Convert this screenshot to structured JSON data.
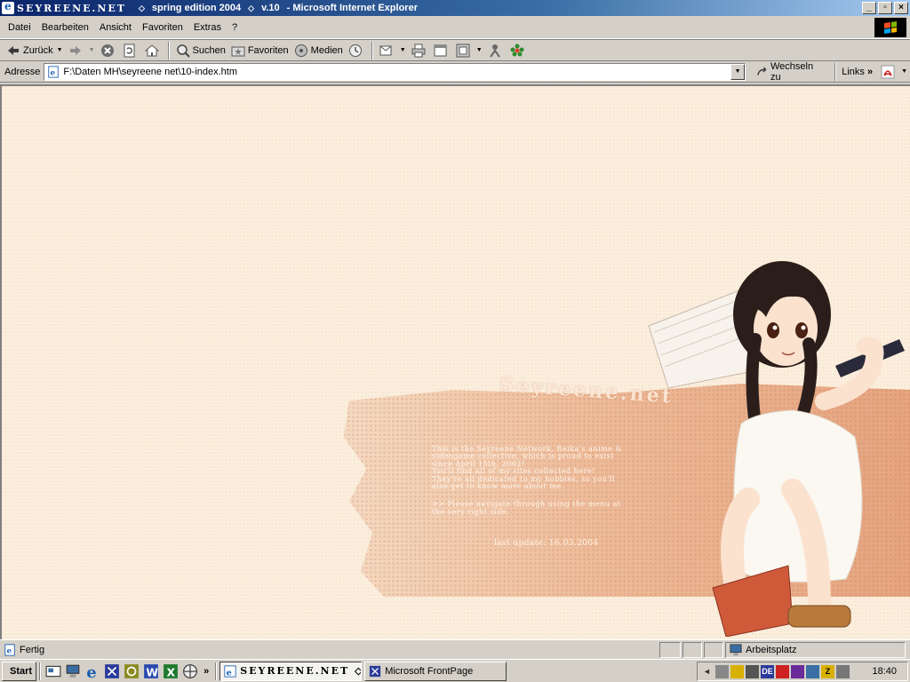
{
  "window": {
    "title_brand": "SEYREENE.NET",
    "title_rest": "spring edition 2004",
    "title_version": "v.10",
    "title_app": "- Microsoft Internet Explorer",
    "diamond": "◇"
  },
  "menu": [
    "Datei",
    "Bearbeiten",
    "Ansicht",
    "Favoriten",
    "Extras",
    "?"
  ],
  "toolbar": {
    "back_label": "Zurück",
    "search_label": "Suchen",
    "favorites_label": "Favoriten",
    "media_label": "Medien"
  },
  "address": {
    "label": "Adresse",
    "value": "F:\\Daten MH\\seyreene net\\10-index.htm",
    "go_label": "Wechseln zu",
    "links_label": "Links",
    "links_chevron": "»"
  },
  "page": {
    "banner_title": "Seyreene.net",
    "intro_line1": "This is the Seyreene Network, Reika's anime &",
    "intro_line2": "videogame collective, which is proud to exist",
    "intro_line3": "since April 15th, 2002!",
    "intro_line4": "You'll find all of my sites collected here!",
    "intro_line5": "They're all dedicated to my hobbies, so you'll",
    "intro_line6": "also get to know more about me.",
    "nav_line1": ">> Please navigate through using the menu at",
    "nav_line2": "the very right side.",
    "last_update": "last update: 16.03.2004"
  },
  "status": {
    "text": "Fertig",
    "zone": "Arbeitsplatz"
  },
  "taskbar": {
    "start_label": "Start",
    "quicklaunch_chevron": "»",
    "tasks": [
      {
        "label": "SEYREENE.NET",
        "suffix": "◇...",
        "active": true
      },
      {
        "label": "Microsoft FrontPage",
        "active": false
      }
    ],
    "tray_lang": "DE",
    "clock": "18:40"
  },
  "colors": {
    "page_bg": "#fbeedd",
    "banner": "#e6a47e",
    "titlebar_start": "#0a246a",
    "titlebar_end": "#a6caf0"
  },
  "icons": [
    "back-arrow-icon",
    "forward-arrow-icon",
    "stop-icon",
    "refresh-icon",
    "home-icon",
    "search-icon",
    "favorites-icon",
    "media-icon",
    "history-icon",
    "mail-icon",
    "print-icon",
    "edit-icon",
    "discuss-icon",
    "messenger-icon",
    "icq-icon"
  ]
}
